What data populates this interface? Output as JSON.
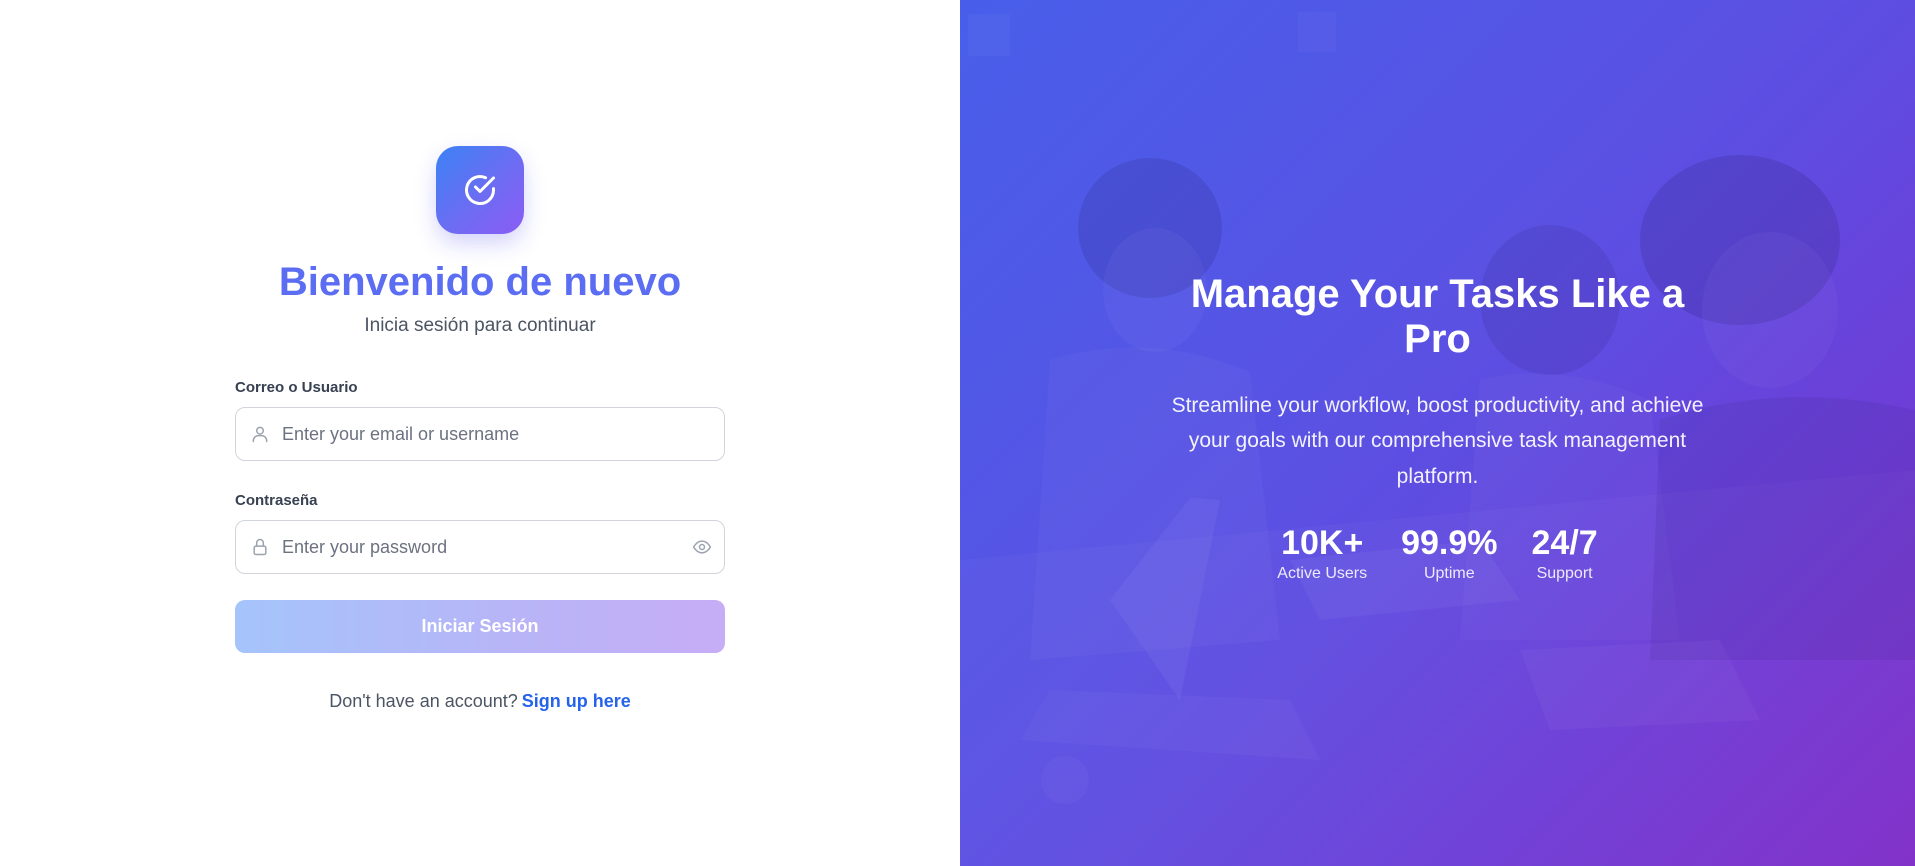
{
  "login": {
    "title": "Bienvenido de nuevo",
    "subtitle": "Inicia sesión para continuar",
    "email_label": "Correo o Usuario",
    "email_placeholder": "Enter your email or username",
    "password_label": "Contraseña",
    "password_placeholder": "Enter your password",
    "submit_label": "Iniciar Sesión",
    "signup_prompt": "Don't have an account?",
    "signup_link": "Sign up here"
  },
  "hero": {
    "title": "Manage Your Tasks Like a Pro",
    "description": "Streamline your workflow, boost productivity, and achieve your goals with our comprehensive task management platform.",
    "stats": [
      {
        "value": "10K+",
        "label": "Active Users"
      },
      {
        "value": "99.9%",
        "label": "Uptime"
      },
      {
        "value": "24/7",
        "label": "Support"
      }
    ]
  },
  "icons": {
    "logo": "check-circle-icon",
    "email_field": "user-icon",
    "password_field": "lock-icon",
    "password_toggle": "eye-icon"
  },
  "colors": {
    "title": "#5b6df2",
    "link": "#2563eb",
    "logo_gradient_start": "#3b82f6",
    "logo_gradient_end": "#8b5cf6",
    "hero_gradient_start": "#4a5ee8",
    "hero_gradient_end": "#7e2ec8"
  }
}
